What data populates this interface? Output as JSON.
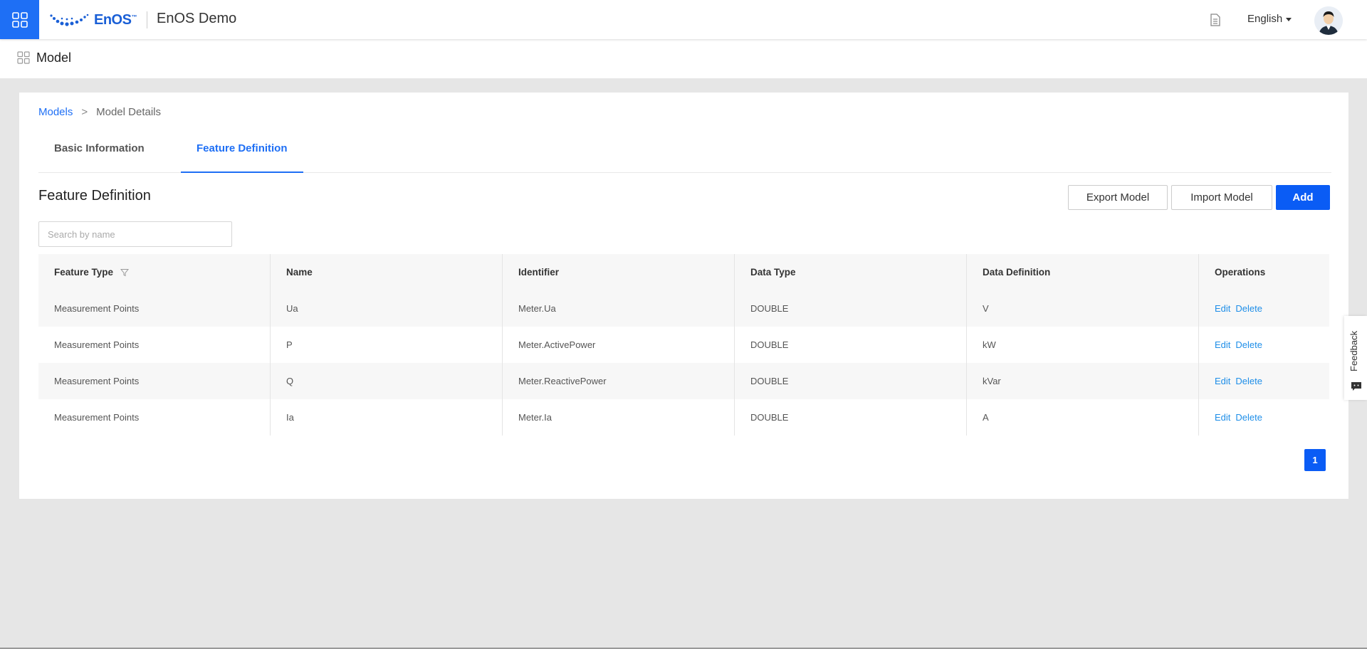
{
  "header": {
    "apps_icon": "grid-icon",
    "logo_text": "EnOS",
    "logo_tm": "™",
    "app_title": "EnOS Demo",
    "doc_icon": "document-icon",
    "language": "English",
    "avatar_icon": "user-avatar"
  },
  "subheader": {
    "icon": "model-icon",
    "title": "Model"
  },
  "breadcrumb": {
    "root": "Models",
    "separator": ">",
    "current": "Model Details"
  },
  "tabs": [
    {
      "label": "Basic Information",
      "active": false
    },
    {
      "label": "Feature Definition",
      "active": true
    }
  ],
  "section_title": "Feature Definition",
  "actions": {
    "export_label": "Export Model",
    "import_label": "Import Model",
    "add_label": "Add"
  },
  "search": {
    "placeholder": "Search by name",
    "value": ""
  },
  "table": {
    "columns": [
      "Feature Type",
      "Name",
      "Identifier",
      "Data Type",
      "Data Definition",
      "Operations"
    ],
    "rows": [
      {
        "feature_type": "Measurement Points",
        "name": "Ua",
        "identifier": "Meter.Ua",
        "data_type": "DOUBLE",
        "data_definition": "V",
        "edit": "Edit",
        "delete": "Delete"
      },
      {
        "feature_type": "Measurement Points",
        "name": "P",
        "identifier": "Meter.ActivePower",
        "data_type": "DOUBLE",
        "data_definition": "kW",
        "edit": "Edit",
        "delete": "Delete"
      },
      {
        "feature_type": "Measurement Points",
        "name": "Q",
        "identifier": "Meter.ReactivePower",
        "data_type": "DOUBLE",
        "data_definition": "kVar",
        "edit": "Edit",
        "delete": "Delete"
      },
      {
        "feature_type": "Measurement Points",
        "name": "Ia",
        "identifier": "Meter.Ia",
        "data_type": "DOUBLE",
        "data_definition": "A",
        "edit": "Edit",
        "delete": "Delete"
      }
    ]
  },
  "pagination": {
    "current_page": "1"
  },
  "feedback": {
    "label": "Feedback",
    "icon": "chat-icon"
  },
  "colors": {
    "primary": "#1e6ff5",
    "add_button": "#0a5cf5",
    "link": "#1e8ee8",
    "page_bg": "#e6e6e6"
  }
}
